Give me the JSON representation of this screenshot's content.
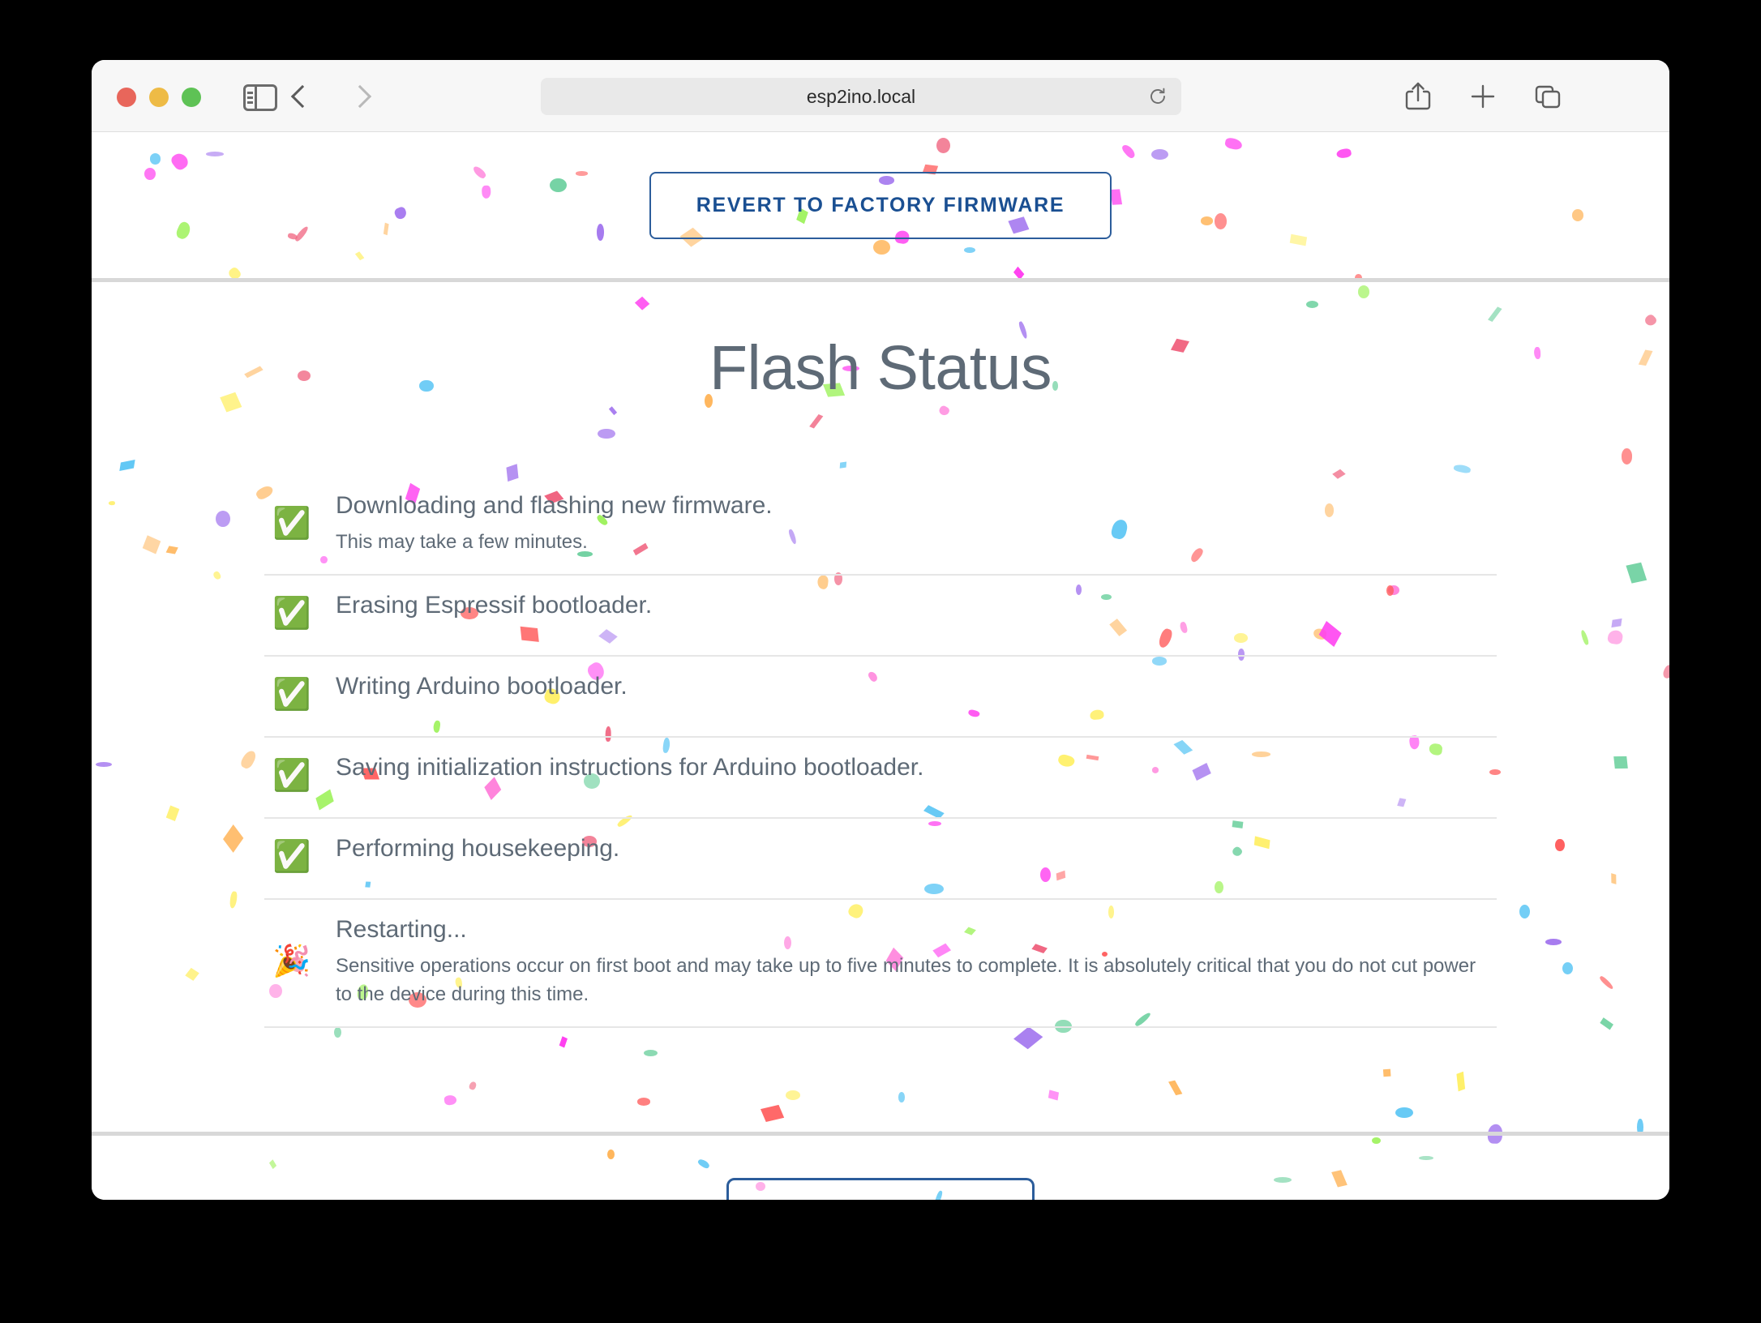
{
  "browser": {
    "url": "esp2ino.local",
    "traffic_lights": [
      "close",
      "minimize",
      "zoom"
    ],
    "icons": {
      "sidebar": "sidebar-icon",
      "back": "chevron-left-icon",
      "forward": "chevron-right-icon",
      "reload": "reload-icon",
      "share": "share-icon",
      "new_tab": "plus-icon",
      "tab_overview": "tab-overview-icon"
    }
  },
  "page": {
    "revert_button_label": "REVERT TO FACTORY FIRMWARE",
    "title": "Flash Status",
    "steps": [
      {
        "icon": "✅",
        "icon_name": "check-mark-button",
        "title": "Downloading and flashing new firmware.",
        "sub": "This may take a few minutes."
      },
      {
        "icon": "✅",
        "icon_name": "check-mark-button",
        "title": "Erasing Espressif bootloader.",
        "sub": ""
      },
      {
        "icon": "✅",
        "icon_name": "check-mark-button",
        "title": "Writing Arduino bootloader.",
        "sub": ""
      },
      {
        "icon": "✅",
        "icon_name": "check-mark-button",
        "title": "Saving initialization instructions for Arduino bootloader.",
        "sub": ""
      },
      {
        "icon": "✅",
        "icon_name": "check-mark-button",
        "title": "Performing housekeeping.",
        "sub": ""
      },
      {
        "icon": "🎉",
        "icon_name": "party-popper",
        "title": "Restarting...",
        "sub": "Sensitive operations occur on first boot and may take up to five minutes to complete. It is absolutely critical that you do not cut power to the device during this time."
      }
    ],
    "bottom_button_label": ""
  },
  "colors": {
    "accent_blue": "#1a4f92",
    "border_blue": "#2c5d9b",
    "text_gray": "#5e6a76",
    "divider_gray": "#d8d8d8",
    "row_divider": "#e6e6e6",
    "toolbar_bg": "#f7f7f7",
    "urlbar_bg": "#e9e9e9",
    "traffic_red": "#e8665b",
    "traffic_yellow": "#eebb46",
    "traffic_green": "#5ec255"
  },
  "confetti_palette": [
    "#ff3ff0",
    "#ffb65c",
    "#a579ef",
    "#f0637f",
    "#fff06a",
    "#9ef25c",
    "#62c8f5",
    "#ff7ad9",
    "#ff5c5c",
    "#6fd1a0"
  ]
}
